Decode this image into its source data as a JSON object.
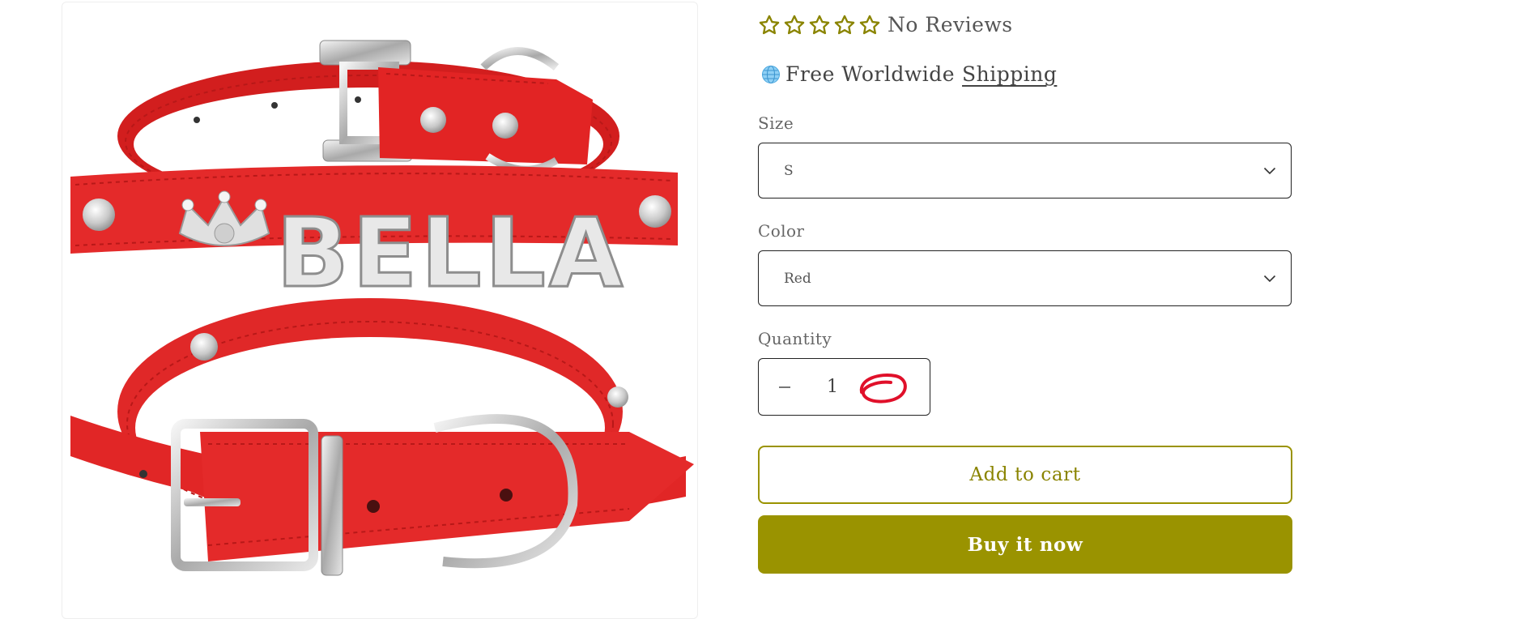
{
  "theme": {
    "accent": "#9a9300",
    "star_color": "#8a8400",
    "product_red": "#e42a2a",
    "annotation_red": "#e0102a"
  },
  "gallery": {
    "image_text": "BELLA"
  },
  "product": {
    "rating": {
      "stars": 0,
      "max_stars": 5,
      "label": "No Reviews"
    },
    "shipping": {
      "text": "Free Worldwide",
      "link": "Shipping"
    },
    "size": {
      "label": "Size",
      "value": "S"
    },
    "color": {
      "label": "Color",
      "value": "Red"
    },
    "quantity": {
      "label": "Quantity",
      "value": "1",
      "decrease_icon": "minus-icon",
      "increase_icon": "plus-icon (scribbled over)"
    },
    "add_to_cart": "Add to cart",
    "buy_now": "Buy it now"
  }
}
